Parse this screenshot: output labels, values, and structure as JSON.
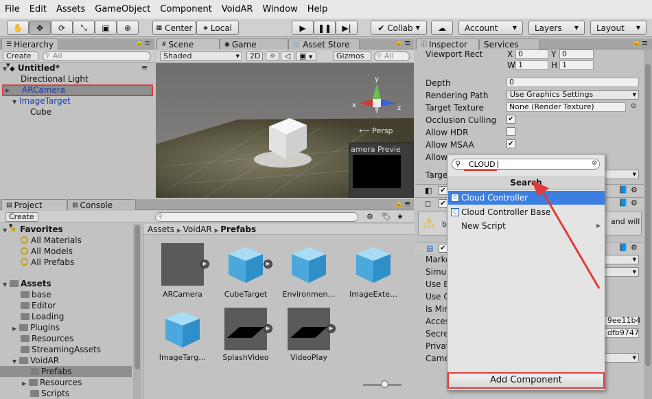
{
  "menu": [
    "File",
    "Edit",
    "Assets",
    "GameObject",
    "Component",
    "VoidAR",
    "Window",
    "Help"
  ],
  "toolbar": {
    "center": "Center",
    "local": "Local",
    "collab": "Collab",
    "account": "Account",
    "layers": "Layers",
    "layout": "Layout"
  },
  "hierarchy": {
    "tab": "Hierarchy",
    "create": "Create",
    "search": "All",
    "scene": "Untitled*",
    "items": [
      "Directional Light",
      "ARCamera",
      "ImageTarget",
      "Cube"
    ]
  },
  "scene": {
    "tabs": [
      "Scene",
      "Game",
      "Asset Store"
    ],
    "shading": "Shaded",
    "mode2d": "2D",
    "gizmos": "Gizmos",
    "search": "All",
    "persp": "Persp",
    "axis_x": "x",
    "axis_y": "y",
    "axis_z": "z",
    "camera_preview": "amera Previe"
  },
  "project": {
    "tabs": [
      "Project",
      "Console"
    ],
    "create": "Create",
    "favorites": "Favorites",
    "fav_items": [
      "All Materials",
      "All Models",
      "All Prefabs"
    ],
    "assets": "Assets",
    "folders": [
      "base",
      "Editor",
      "Loading",
      "Plugins",
      "Resources",
      "StreamingAssets",
      "VoidAR",
      "Prefabs",
      "Resources",
      "Scripts"
    ],
    "breadcrumb": [
      "Assets",
      "VoidAR",
      "Prefabs"
    ],
    "grid": [
      "ARCamera",
      "CubeTarget",
      "Environmen…",
      "ImageExte…",
      "ImageTarg…",
      "SplashVideo",
      "VideoPlay"
    ]
  },
  "inspector": {
    "tabs": [
      "Inspector",
      "Services"
    ],
    "viewport_rect": "Viewport Rect",
    "vr": {
      "x_label": "X",
      "x": "0",
      "y_label": "Y",
      "y": "0",
      "w_label": "W",
      "w": "1",
      "h_label": "H",
      "h": "1"
    },
    "depth_label": "Depth",
    "depth": "0",
    "rendering_path_label": "Rendering Path",
    "rendering_path": "Use Graphics Settings",
    "target_texture_label": "Target Texture",
    "target_texture": "None (Render Texture)",
    "occlusion_label": "Occlusion Culling",
    "hdr_label": "Allow HDR",
    "msaa_label": "Allow MSAA",
    "allow_label": "Allow",
    "target_label": "Targe",
    "warning_text": "and will",
    "warning_b": "b",
    "partial_labels": [
      "Marke",
      "Simul",
      "Use E",
      "Use C",
      "Is Mir",
      "Acces",
      "Secre",
      "Privat",
      "Came"
    ],
    "access_value": "9ee11b4",
    "secret_value": "dfb9747"
  },
  "popup": {
    "query": "CLOUD",
    "header": "Search",
    "results": [
      "Cloud Controller",
      "Cloud Controller Base",
      "New Script"
    ],
    "add_component": "Add Component"
  },
  "colors": {
    "highlight": "#3d7ee3",
    "annotation": "#e23b3b"
  }
}
